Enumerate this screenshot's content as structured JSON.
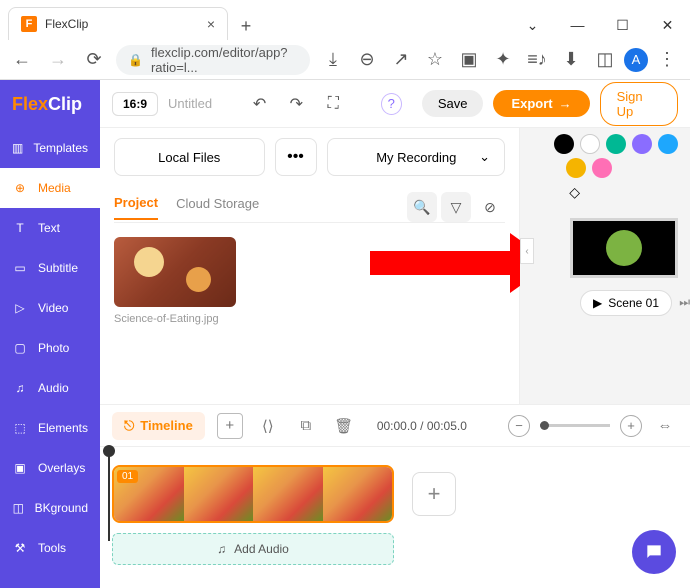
{
  "browser": {
    "tab_title": "FlexClip",
    "url": "flexclip.com/editor/app?ratio=l...",
    "avatar_letter": "A"
  },
  "app": {
    "logo_text_1": "Flex",
    "logo_text_2": "Clip",
    "rail": [
      {
        "icon": "▥",
        "label": "Templates"
      },
      {
        "icon": "⊕",
        "label": "Media"
      },
      {
        "icon": "T",
        "label": "Text"
      },
      {
        "icon": "▭",
        "label": "Subtitle"
      },
      {
        "icon": "▷",
        "label": "Video"
      },
      {
        "icon": "▢",
        "label": "Photo"
      },
      {
        "icon": "♫",
        "label": "Audio"
      },
      {
        "icon": "⬚",
        "label": "Elements"
      },
      {
        "icon": "▣",
        "label": "Overlays"
      },
      {
        "icon": "◫",
        "label": "BKground"
      },
      {
        "icon": "⚒",
        "label": "Tools"
      }
    ],
    "active_rail_index": 1,
    "topbar": {
      "ratio": "16:9",
      "title": "Untitled",
      "save": "Save",
      "export": "Export",
      "signup": "Sign Up"
    },
    "media": {
      "local_files": "Local Files",
      "recording": "My Recording",
      "tabs": {
        "project": "Project",
        "cloud": "Cloud Storage"
      },
      "thumb_name": "Science-of-Eating.jpg"
    },
    "scene": {
      "colors_row1": [
        "#000000",
        "#ffffff",
        "#00b894",
        "#8a6dff",
        "#1ea7fd"
      ],
      "colors_row2": [
        "#f5b400",
        "#ff6fb5"
      ],
      "label": "Scene 01"
    },
    "timeline": {
      "btn": "Timeline",
      "time": "00:00.0 / 00:05.0",
      "clip_badge": "01",
      "add_audio": "Add Audio"
    }
  }
}
